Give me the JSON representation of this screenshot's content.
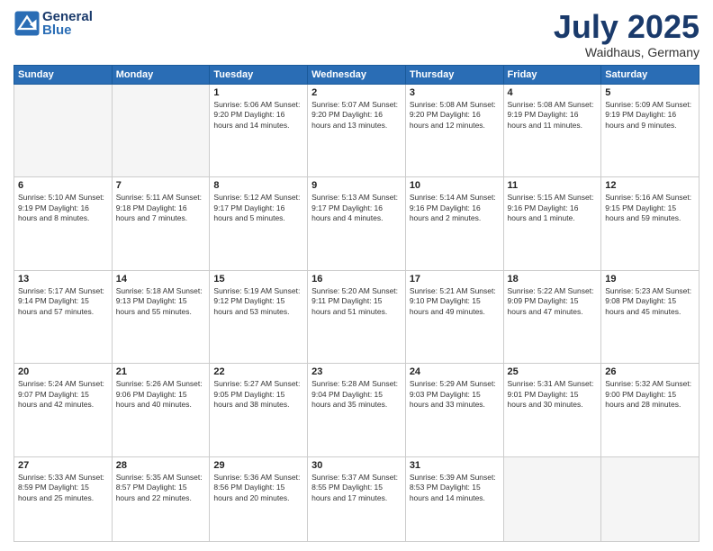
{
  "header": {
    "logo_line1": "General",
    "logo_line2": "Blue",
    "month": "July 2025",
    "location": "Waidhaus, Germany"
  },
  "weekdays": [
    "Sunday",
    "Monday",
    "Tuesday",
    "Wednesday",
    "Thursday",
    "Friday",
    "Saturday"
  ],
  "weeks": [
    [
      {
        "day": "",
        "info": ""
      },
      {
        "day": "",
        "info": ""
      },
      {
        "day": "1",
        "info": "Sunrise: 5:06 AM\nSunset: 9:20 PM\nDaylight: 16 hours\nand 14 minutes."
      },
      {
        "day": "2",
        "info": "Sunrise: 5:07 AM\nSunset: 9:20 PM\nDaylight: 16 hours\nand 13 minutes."
      },
      {
        "day": "3",
        "info": "Sunrise: 5:08 AM\nSunset: 9:20 PM\nDaylight: 16 hours\nand 12 minutes."
      },
      {
        "day": "4",
        "info": "Sunrise: 5:08 AM\nSunset: 9:19 PM\nDaylight: 16 hours\nand 11 minutes."
      },
      {
        "day": "5",
        "info": "Sunrise: 5:09 AM\nSunset: 9:19 PM\nDaylight: 16 hours\nand 9 minutes."
      }
    ],
    [
      {
        "day": "6",
        "info": "Sunrise: 5:10 AM\nSunset: 9:19 PM\nDaylight: 16 hours\nand 8 minutes."
      },
      {
        "day": "7",
        "info": "Sunrise: 5:11 AM\nSunset: 9:18 PM\nDaylight: 16 hours\nand 7 minutes."
      },
      {
        "day": "8",
        "info": "Sunrise: 5:12 AM\nSunset: 9:17 PM\nDaylight: 16 hours\nand 5 minutes."
      },
      {
        "day": "9",
        "info": "Sunrise: 5:13 AM\nSunset: 9:17 PM\nDaylight: 16 hours\nand 4 minutes."
      },
      {
        "day": "10",
        "info": "Sunrise: 5:14 AM\nSunset: 9:16 PM\nDaylight: 16 hours\nand 2 minutes."
      },
      {
        "day": "11",
        "info": "Sunrise: 5:15 AM\nSunset: 9:16 PM\nDaylight: 16 hours\nand 1 minute."
      },
      {
        "day": "12",
        "info": "Sunrise: 5:16 AM\nSunset: 9:15 PM\nDaylight: 15 hours\nand 59 minutes."
      }
    ],
    [
      {
        "day": "13",
        "info": "Sunrise: 5:17 AM\nSunset: 9:14 PM\nDaylight: 15 hours\nand 57 minutes."
      },
      {
        "day": "14",
        "info": "Sunrise: 5:18 AM\nSunset: 9:13 PM\nDaylight: 15 hours\nand 55 minutes."
      },
      {
        "day": "15",
        "info": "Sunrise: 5:19 AM\nSunset: 9:12 PM\nDaylight: 15 hours\nand 53 minutes."
      },
      {
        "day": "16",
        "info": "Sunrise: 5:20 AM\nSunset: 9:11 PM\nDaylight: 15 hours\nand 51 minutes."
      },
      {
        "day": "17",
        "info": "Sunrise: 5:21 AM\nSunset: 9:10 PM\nDaylight: 15 hours\nand 49 minutes."
      },
      {
        "day": "18",
        "info": "Sunrise: 5:22 AM\nSunset: 9:09 PM\nDaylight: 15 hours\nand 47 minutes."
      },
      {
        "day": "19",
        "info": "Sunrise: 5:23 AM\nSunset: 9:08 PM\nDaylight: 15 hours\nand 45 minutes."
      }
    ],
    [
      {
        "day": "20",
        "info": "Sunrise: 5:24 AM\nSunset: 9:07 PM\nDaylight: 15 hours\nand 42 minutes."
      },
      {
        "day": "21",
        "info": "Sunrise: 5:26 AM\nSunset: 9:06 PM\nDaylight: 15 hours\nand 40 minutes."
      },
      {
        "day": "22",
        "info": "Sunrise: 5:27 AM\nSunset: 9:05 PM\nDaylight: 15 hours\nand 38 minutes."
      },
      {
        "day": "23",
        "info": "Sunrise: 5:28 AM\nSunset: 9:04 PM\nDaylight: 15 hours\nand 35 minutes."
      },
      {
        "day": "24",
        "info": "Sunrise: 5:29 AM\nSunset: 9:03 PM\nDaylight: 15 hours\nand 33 minutes."
      },
      {
        "day": "25",
        "info": "Sunrise: 5:31 AM\nSunset: 9:01 PM\nDaylight: 15 hours\nand 30 minutes."
      },
      {
        "day": "26",
        "info": "Sunrise: 5:32 AM\nSunset: 9:00 PM\nDaylight: 15 hours\nand 28 minutes."
      }
    ],
    [
      {
        "day": "27",
        "info": "Sunrise: 5:33 AM\nSunset: 8:59 PM\nDaylight: 15 hours\nand 25 minutes."
      },
      {
        "day": "28",
        "info": "Sunrise: 5:35 AM\nSunset: 8:57 PM\nDaylight: 15 hours\nand 22 minutes."
      },
      {
        "day": "29",
        "info": "Sunrise: 5:36 AM\nSunset: 8:56 PM\nDaylight: 15 hours\nand 20 minutes."
      },
      {
        "day": "30",
        "info": "Sunrise: 5:37 AM\nSunset: 8:55 PM\nDaylight: 15 hours\nand 17 minutes."
      },
      {
        "day": "31",
        "info": "Sunrise: 5:39 AM\nSunset: 8:53 PM\nDaylight: 15 hours\nand 14 minutes."
      },
      {
        "day": "",
        "info": ""
      },
      {
        "day": "",
        "info": ""
      }
    ]
  ]
}
